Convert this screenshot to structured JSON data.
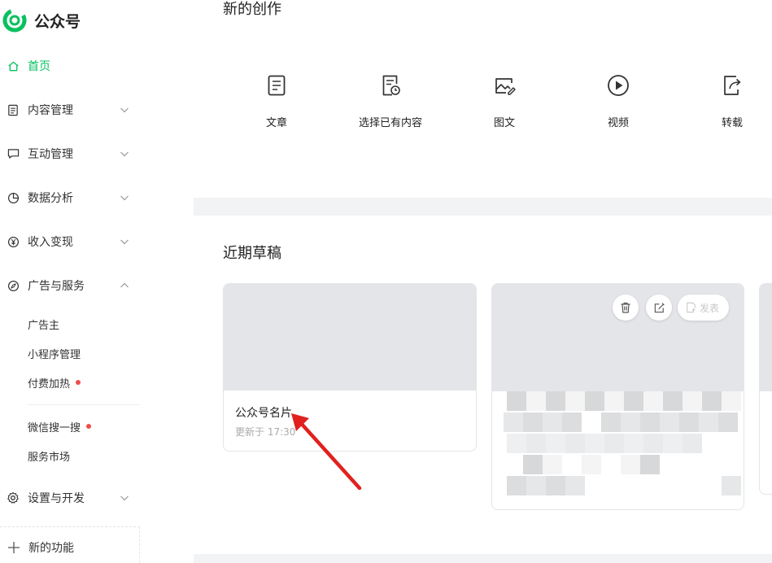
{
  "app": {
    "title": "公众号",
    "brand_color": "#07c160",
    "logo_icon": "wechat-official-account-logo"
  },
  "sidebar": {
    "items": [
      {
        "label": "首页",
        "icon": "home-icon",
        "active": true,
        "chevron": "none"
      },
      {
        "label": "内容管理",
        "icon": "document-icon",
        "chevron": "down"
      },
      {
        "label": "互动管理",
        "icon": "chat-bubble-icon",
        "chevron": "down"
      },
      {
        "label": "数据分析",
        "icon": "pie-chart-icon",
        "chevron": "down"
      },
      {
        "label": "收入变现",
        "icon": "yen-icon",
        "chevron": "down"
      },
      {
        "label": "广告与服务",
        "icon": "compass-icon",
        "chevron": "up"
      }
    ],
    "sub_items_group1": [
      {
        "label": "广告主",
        "badge": false
      },
      {
        "label": "小程序管理",
        "badge": false
      },
      {
        "label": "付费加热",
        "badge": true
      }
    ],
    "sub_items_group2": [
      {
        "label": "微信搜一搜",
        "badge": true
      },
      {
        "label": "服务市场",
        "badge": false
      }
    ],
    "settings": {
      "label": "设置与开发",
      "icon": "gear-icon",
      "chevron": "down"
    },
    "new_feature": {
      "label": "新的功能",
      "icon": "plus-icon"
    },
    "badge_color": "#f04c4c"
  },
  "create": {
    "title": "新的创作",
    "items": [
      {
        "label": "文章",
        "icon": "article-icon"
      },
      {
        "label": "选择已有内容",
        "icon": "existing-content-icon"
      },
      {
        "label": "图文",
        "icon": "image-text-icon"
      },
      {
        "label": "视频",
        "icon": "video-play-icon"
      },
      {
        "label": "转载",
        "icon": "repost-icon"
      }
    ]
  },
  "drafts": {
    "title": "近期草稿",
    "card1": {
      "title": "公众号名片",
      "time": "更新于 17:30"
    },
    "card2": {
      "publish_label": "发表",
      "delete_icon": "trash-icon",
      "edit_icon": "edit-icon"
    }
  }
}
